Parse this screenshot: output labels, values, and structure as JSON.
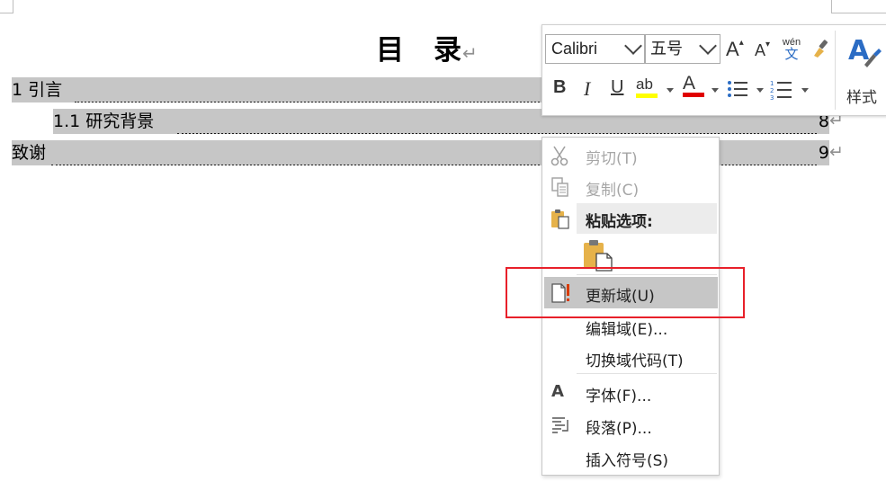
{
  "document": {
    "title": "目　录",
    "paragraph_mark": "↵",
    "toc": [
      {
        "text": "1 引言",
        "page": ""
      },
      {
        "text": "1.1 研究背景",
        "page": "8"
      },
      {
        "text": "致谢",
        "page": "9"
      }
    ]
  },
  "mini_toolbar": {
    "font_name": "Calibri",
    "font_size": "五号",
    "grow_font": "A",
    "shrink_font": "A",
    "phonetic_top": "wén",
    "phonetic_bottom": "文",
    "bold": "B",
    "italic": "I",
    "underline": "U",
    "highlight": "ab",
    "font_color": "A",
    "styles_label": "样式",
    "highlight_color": "#ffff00",
    "font_color_value": "#e00000"
  },
  "context_menu": {
    "items": [
      {
        "label": "剪切(T)",
        "icon": "scissors-icon",
        "disabled": true
      },
      {
        "label": "复制(C)",
        "icon": "copy-icon",
        "disabled": true
      },
      {
        "label": "粘贴选项:",
        "icon": "paste-icon",
        "disabled": false
      },
      {
        "label": "更新域(U)",
        "icon": "update-field-icon",
        "disabled": false,
        "highlighted": true
      },
      {
        "label": "编辑域(E)...",
        "icon": "",
        "disabled": false
      },
      {
        "label": "切换域代码(T)",
        "icon": "",
        "disabled": false
      },
      {
        "label": "字体(F)...",
        "icon": "font-icon",
        "disabled": false
      },
      {
        "label": "段落(P)...",
        "icon": "paragraph-icon",
        "disabled": false
      },
      {
        "label": "插入符号(S)",
        "icon": "",
        "disabled": false
      }
    ]
  },
  "colors": {
    "field_shading": "#c6c6c6",
    "annotation_box": "#e8202a",
    "paste_icon": "#e6b24a",
    "update_icon_red": "#d83b01"
  }
}
